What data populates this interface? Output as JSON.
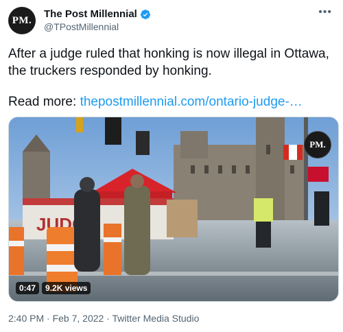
{
  "author": {
    "avatar_text": "PM.",
    "display_name": "The Post Millennial",
    "handle": "@TPostMillennial",
    "verified": true
  },
  "more_icon": "more-horizontal-icon",
  "tweet": {
    "text": "After a judge ruled that honking is now illegal in Ottawa, the truckers responded by honking.",
    "read_more_label": "Read more:",
    "link_text": "thepostmillennial.com/ontario-judge-…"
  },
  "media": {
    "watermark": "PM.",
    "duration": "0:47",
    "views": "9.2K views",
    "banner_text": "JUDGE"
  },
  "footer": {
    "time": "2:40 PM",
    "date": "Feb 7, 2022",
    "source": "Twitter Media Studio",
    "separator": "·"
  },
  "colors": {
    "accent": "#1d9bf0",
    "text": "#0f1419",
    "muted": "#536471"
  }
}
